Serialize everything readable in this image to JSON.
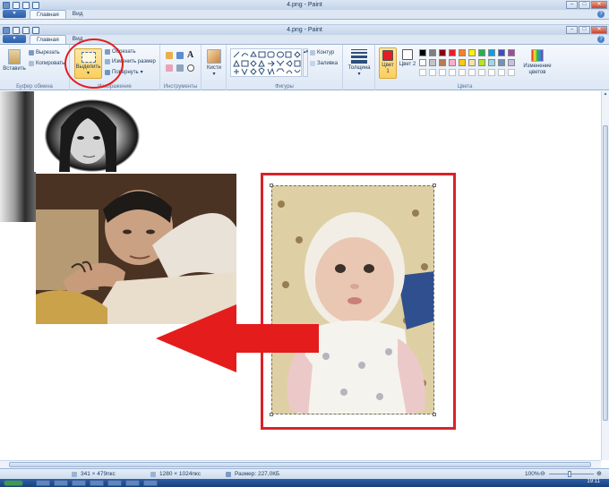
{
  "window": {
    "title_back": "4.png - Paint",
    "title_front": "4.png - Paint"
  },
  "tabs": {
    "home": "Главная",
    "view": "Вид"
  },
  "clipboard": {
    "paste": "Вставить",
    "cut": "Вырезать",
    "copy": "Копировать",
    "group_label": "Буфер обмена"
  },
  "image": {
    "select": "Выделить",
    "crop": "Обрезать",
    "resize": "Изменить размер",
    "rotate": "Повернуть",
    "group_label": "Изображение"
  },
  "tools": {
    "group_label": "Инструменты"
  },
  "brushes": {
    "label": "Кисти"
  },
  "shapes": {
    "outline": "Контур",
    "fill": "Заливка",
    "group_label": "Фигуры"
  },
  "thickness": {
    "label": "Толщина"
  },
  "colors": {
    "color1_label": "Цвет 1",
    "color2_label": "Цвет 2",
    "edit_colors": "Изменение цветов",
    "group_label": "Цвета",
    "color1": "#e51c23",
    "color2": "#ffffff",
    "palette": [
      "#000000",
      "#7f7f7f",
      "#880015",
      "#ed1c24",
      "#ff7f27",
      "#fff200",
      "#22b14c",
      "#00a2e8",
      "#3f48cc",
      "#a349a4",
      "#ffffff",
      "#c3c3c3",
      "#b97a57",
      "#ffaec9",
      "#ffc90e",
      "#efe4b0",
      "#b5e61d",
      "#99d9ea",
      "#7092be",
      "#c8bfe7"
    ]
  },
  "status": {
    "selection_size": "341 × 479пкс",
    "image_size": "1280 × 1024пкс",
    "file_size": "Размер: 227,0КБ",
    "zoom": "100%",
    "clock": "19:11"
  },
  "annotation": {
    "arrow_color": "#e41c1c",
    "frame_color": "#d8232a"
  }
}
